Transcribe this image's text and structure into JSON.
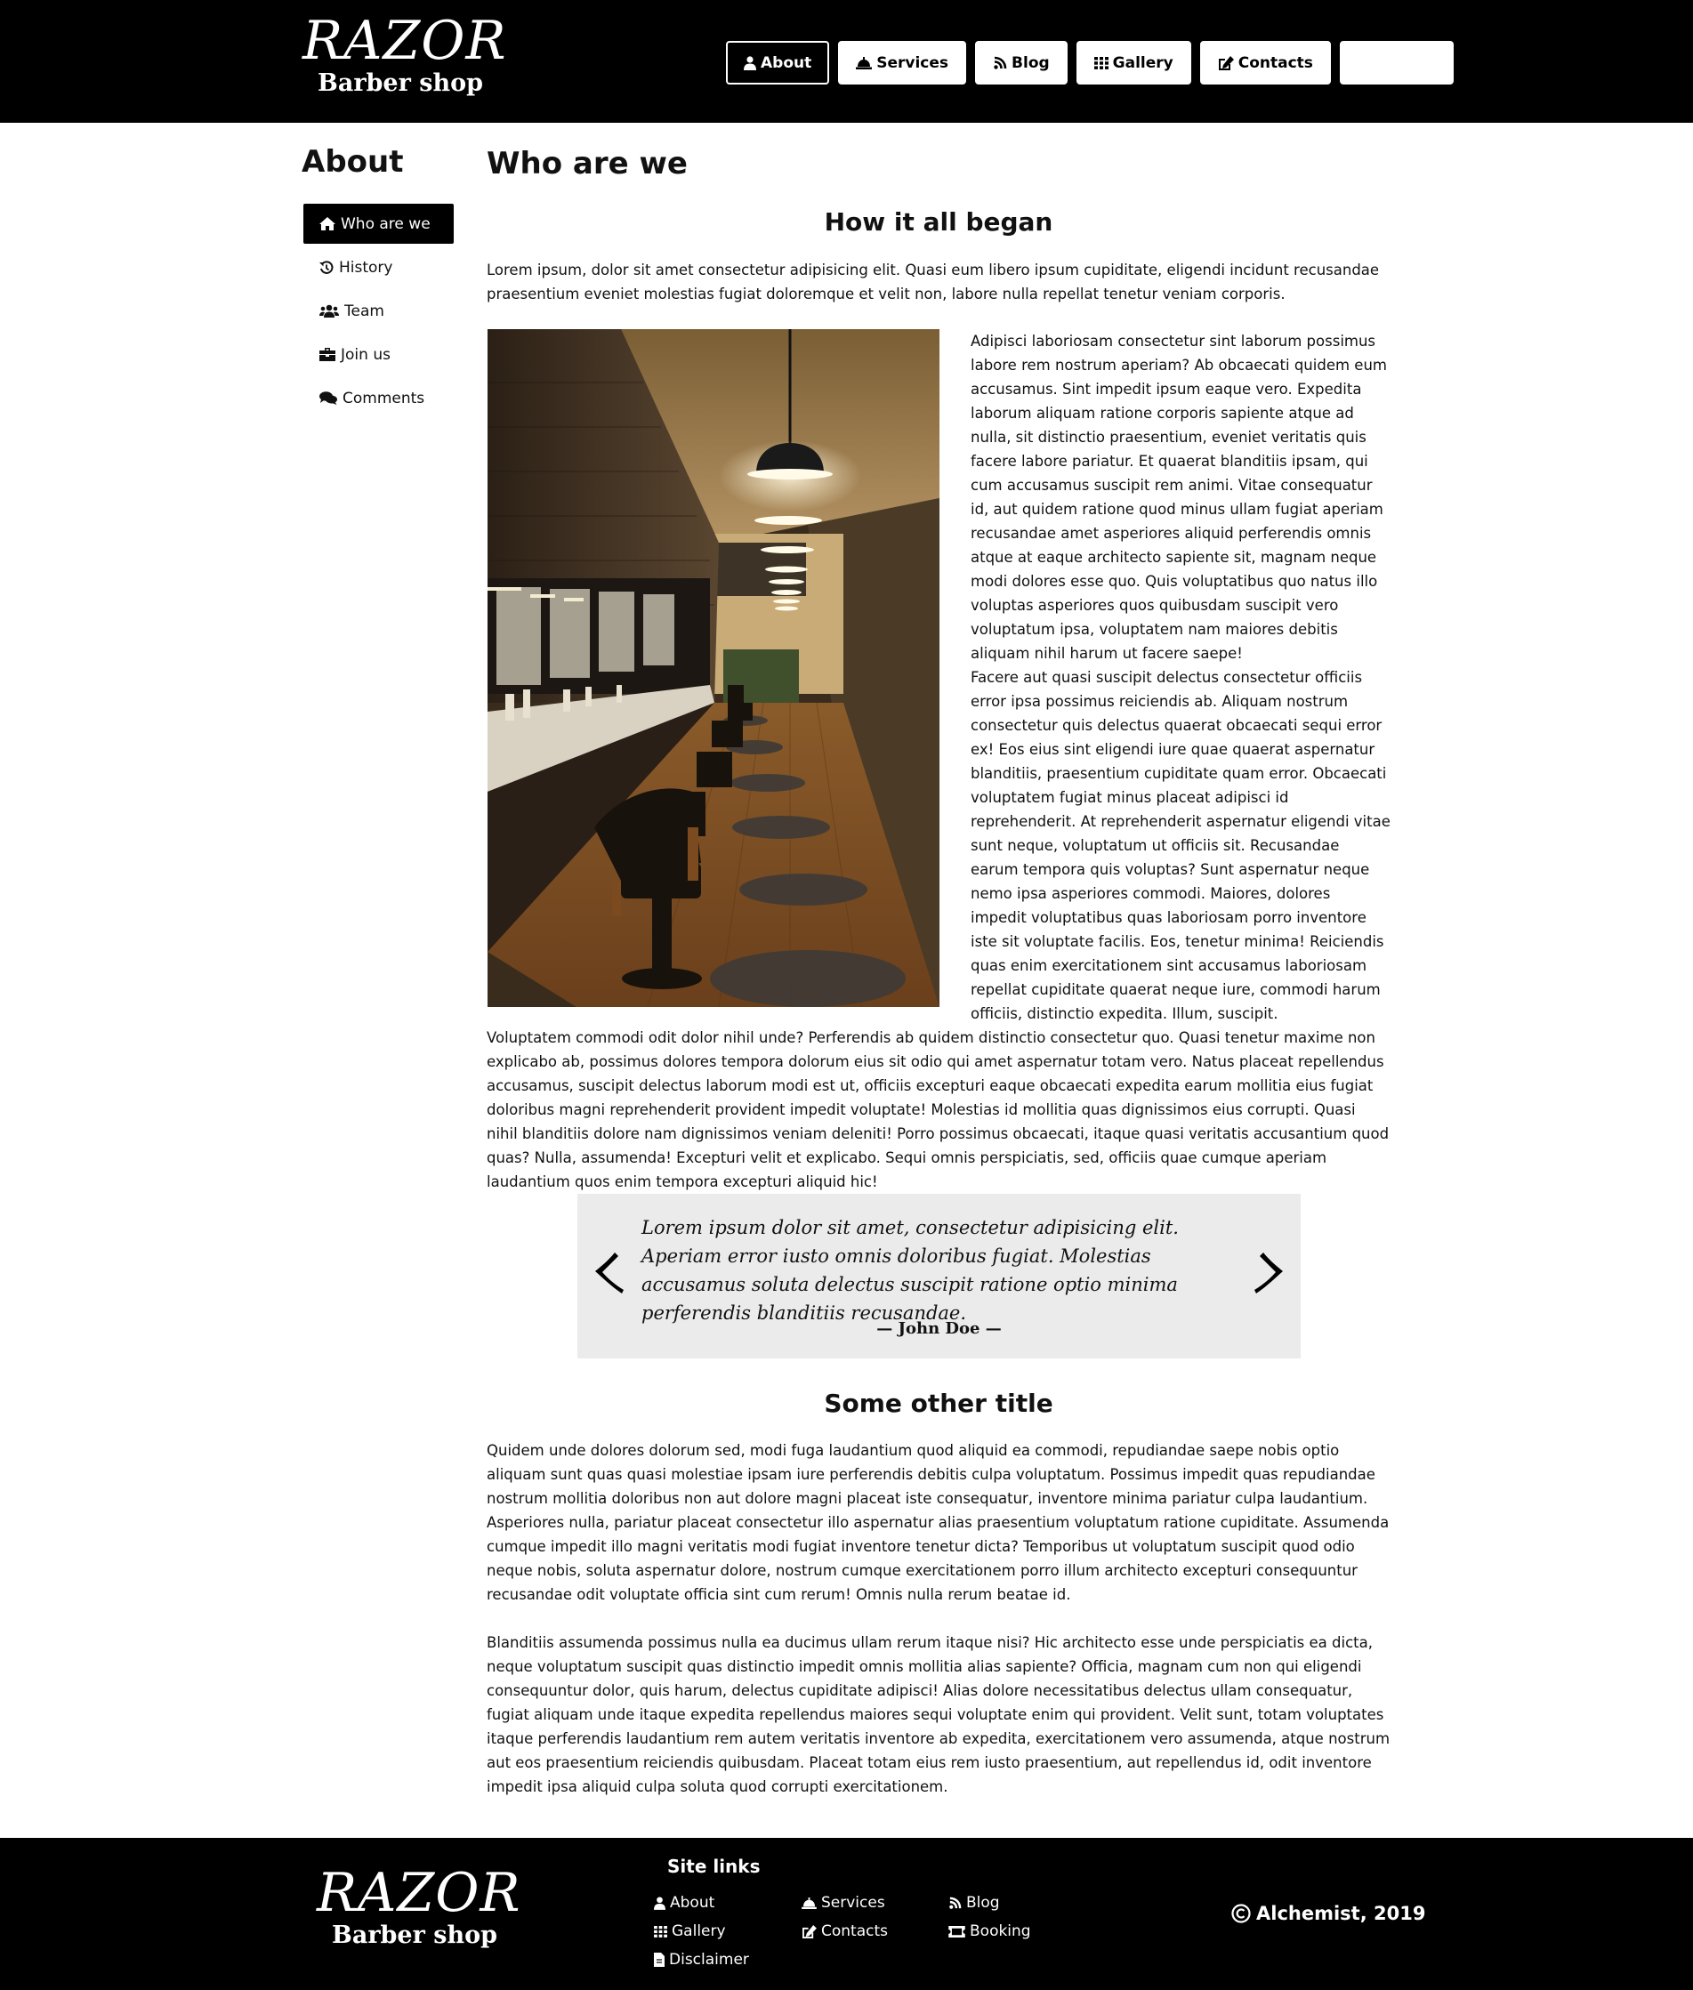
{
  "header": {
    "logo": {
      "brand": "RAZOR",
      "sub": "Barber shop"
    },
    "nav": [
      {
        "label": "About",
        "icon": "user-icon",
        "active": true
      },
      {
        "label": "Services",
        "icon": "service-bell-icon"
      },
      {
        "label": "Blog",
        "icon": "blog-icon"
      },
      {
        "label": "Gallery",
        "icon": "grid-icon"
      },
      {
        "label": "Contacts",
        "icon": "edit-icon"
      },
      {
        "label": "",
        "icon": ""
      }
    ]
  },
  "sidebar": {
    "title": "About",
    "items": [
      {
        "label": "Who are we",
        "icon": "home-icon",
        "active": true
      },
      {
        "label": "History",
        "icon": "history-icon"
      },
      {
        "label": "Team",
        "icon": "users-icon"
      },
      {
        "label": "Join us",
        "icon": "briefcase-icon"
      },
      {
        "label": "Comments",
        "icon": "comments-icon"
      }
    ]
  },
  "main": {
    "title": "Who are we",
    "section1": {
      "title": "How it all began",
      "intro": "Lorem ipsum, dolor sit amet consectetur adipisicing elit. Quasi eum libero ipsum cupiditate, eligendi incidunt recusandae praesentium eveniet molestias fugiat doloremque et velit non, labore nulla repellat tenetur veniam corporis.",
      "side_p1": "Adipisci laboriosam consectetur sint laborum possimus labore rem nostrum aperiam? Ab obcaecati quidem eum accusamus. Sint impedit ipsum eaque vero. Expedita laborum aliquam ratione corporis sapiente atque ad nulla, sit distinctio praesentium, eveniet veritatis quis facere labore pariatur. Et quaerat blanditiis ipsam, qui cum accusamus suscipit rem animi. Vitae consequatur id, aut quidem ratione quod minus ullam fugiat aperiam recusandae amet asperiores aliquid perferendis omnis atque at eaque architecto sapiente sit, magnam neque modi dolores esse quo. Quis voluptatibus quo natus illo voluptas asperiores quos quibusdam suscipit vero voluptatum ipsa, voluptatem nam maiores debitis aliquam nihil harum ut facere saepe!",
      "side_p2": "Facere aut quasi suscipit delectus consectetur officiis error ipsa possimus reiciendis ab. Aliquam nostrum consectetur quis delectus quaerat obcaecati sequi error ex! Eos eius sint eligendi iure quae quaerat aspernatur blanditiis, praesentium cupiditate quam error. Obcaecati voluptatem fugiat minus placeat adipisci id reprehenderit. At reprehenderit aspernatur eligendi vitae sunt neque, voluptatum ut officiis sit. Recusandae earum tempora quis voluptas? Sunt aspernatur neque nemo ipsa asperiores commodi. Maiores, dolores impedit voluptatibus quas laboriosam porro inventore iste sit voluptate facilis. Eos, tenetur minima! Reiciendis quas enim exercitationem sint accusamus laboriosam repellat cupiditate quaerat neque iure, commodi harum officiis, distinctio expedita. Illum, suscipit.",
      "after": "Voluptatem commodi odit dolor nihil unde? Perferendis ab quidem distinctio consectetur quo. Quasi tenetur maxime non explicabo ab, possimus dolores tempora dolorum eius sit odio qui amet aspernatur totam vero. Natus placeat repellendus accusamus, suscipit delectus laborum modi est ut, officiis excepturi eaque obcaecati expedita earum mollitia eius fugiat doloribus magni reprehenderit provident impedit voluptate! Molestias id mollitia quas dignissimos eius corrupti. Quasi nihil blanditiis dolore nam dignissimos veniam deleniti! Porro possimus obcaecati, itaque quasi veritatis accusantium quod quas? Nulla, assumenda! Excepturi velit et explicabo. Sequi omnis perspiciatis, sed, officiis quae cumque aperiam laudantium quos enim tempora excepturi aliquid hic!"
    },
    "quote": {
      "text": "Lorem ipsum dolor sit amet, consectetur adipisicing elit. Aperiam error iusto omnis doloribus fugiat. Molestias accusamus soluta delectus suscipit ratione optio minima perferendis blanditiis recusandae.",
      "author": "— John Doe —"
    },
    "section2": {
      "title": "Some other title",
      "p1": "Quidem unde dolores dolorum sed, modi fuga laudantium quod aliquid ea commodi, repudiandae saepe nobis optio aliquam sunt quas quasi molestiae ipsam iure perferendis debitis culpa voluptatum. Possimus impedit quas repudiandae nostrum mollitia doloribus non aut dolore magni placeat iste consequatur, inventore minima pariatur culpa laudantium. Asperiores nulla, pariatur placeat consectetur illo aspernatur alias praesentium voluptatum ratione cupiditate. Assumenda cumque impedit illo magni veritatis modi fugiat inventore tenetur dicta? Temporibus ut voluptatum suscipit quod odio neque nobis, soluta aspernatur dolore, nostrum cumque exercitationem porro illum architecto excepturi consequuntur recusandae odit voluptate officia sint cum rerum! Omnis nulla rerum beatae id.",
      "p2": "Blanditiis assumenda possimus nulla ea ducimus ullam rerum itaque nisi? Hic architecto esse unde perspiciatis ea dicta, neque voluptatum suscipit quas distinctio impedit omnis mollitia alias sapiente? Officia, magnam cum non qui eligendi consequuntur dolor, quis harum, delectus cupiditate adipisci! Alias dolore necessitatibus delectus ullam consequatur, fugiat aliquam unde itaque expedita repellendus maiores sequi voluptate enim qui provident. Velit sunt, totam voluptates itaque perferendis laudantium rem autem veritatis inventore ab expedita, exercitationem vero assumenda, atque nostrum aut eos praesentium reiciendis quibusdam. Placeat totam eius rem iusto praesentium, aut repellendus id, odit inventore impedit ipsa aliquid culpa soluta quod corrupti exercitationem."
    }
  },
  "footer": {
    "logo": {
      "brand": "RAZOR",
      "sub": "Barber shop"
    },
    "links_title": "Site links",
    "links": [
      {
        "label": "About",
        "icon": "user-icon"
      },
      {
        "label": "Services",
        "icon": "service-bell-icon"
      },
      {
        "label": "Blog",
        "icon": "blog-icon"
      },
      {
        "label": "Gallery",
        "icon": "grid-icon"
      },
      {
        "label": "Contacts",
        "icon": "edit-icon"
      },
      {
        "label": "Booking",
        "icon": "ticket-icon"
      },
      {
        "label": "Disclaimer",
        "icon": "document-icon"
      }
    ],
    "copyright": "Alchemist, 2019"
  }
}
